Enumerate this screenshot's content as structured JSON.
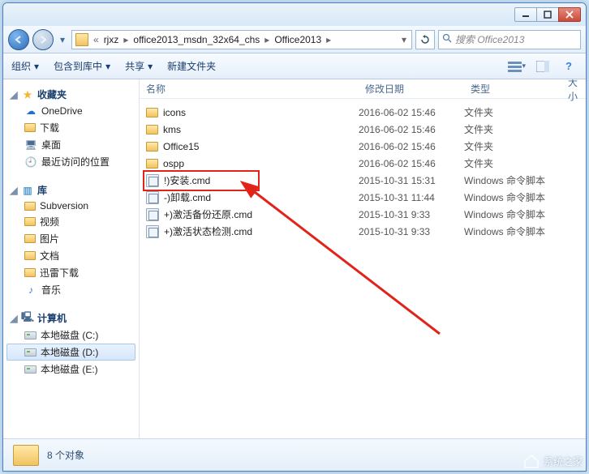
{
  "breadcrumb": {
    "items": [
      "rjxz",
      "office2013_msdn_32x64_chs",
      "Office2013"
    ]
  },
  "search": {
    "placeholder": "搜索 Office2013"
  },
  "toolbar": {
    "organize": "组织",
    "include": "包含到库中",
    "share": "共享",
    "newfolder": "新建文件夹"
  },
  "nav": {
    "favorites": {
      "label": "收藏夹",
      "items": [
        "OneDrive",
        "下载",
        "桌面",
        "最近访问的位置"
      ]
    },
    "libraries": {
      "label": "库",
      "items": [
        "Subversion",
        "视频",
        "图片",
        "文档",
        "迅雷下载",
        "音乐"
      ]
    },
    "computer": {
      "label": "计算机",
      "items": [
        "本地磁盘 (C:)",
        "本地磁盘 (D:)",
        "本地磁盘 (E:)"
      ]
    }
  },
  "columns": {
    "name": "名称",
    "date": "修改日期",
    "type": "类型",
    "size": "大小"
  },
  "files": [
    {
      "name": "icons",
      "date": "2016-06-02 15:46",
      "type": "文件夹",
      "kind": "folder"
    },
    {
      "name": "kms",
      "date": "2016-06-02 15:46",
      "type": "文件夹",
      "kind": "folder"
    },
    {
      "name": "Office15",
      "date": "2016-06-02 15:46",
      "type": "文件夹",
      "kind": "folder"
    },
    {
      "name": "ospp",
      "date": "2016-06-02 15:46",
      "type": "文件夹",
      "kind": "folder"
    },
    {
      "name": "!)安装.cmd",
      "date": "2015-10-31 15:31",
      "type": "Windows 命令脚本",
      "kind": "cmd"
    },
    {
      "name": "-)卸载.cmd",
      "date": "2015-10-31 11:44",
      "type": "Windows 命令脚本",
      "kind": "cmd"
    },
    {
      "name": "+)激活备份还原.cmd",
      "date": "2015-10-31 9:33",
      "type": "Windows 命令脚本",
      "kind": "cmd"
    },
    {
      "name": "+)激活状态检测.cmd",
      "date": "2015-10-31 9:33",
      "type": "Windows 命令脚本",
      "kind": "cmd"
    }
  ],
  "status": {
    "count_text": "8 个对象"
  },
  "watermark": "系统之家"
}
